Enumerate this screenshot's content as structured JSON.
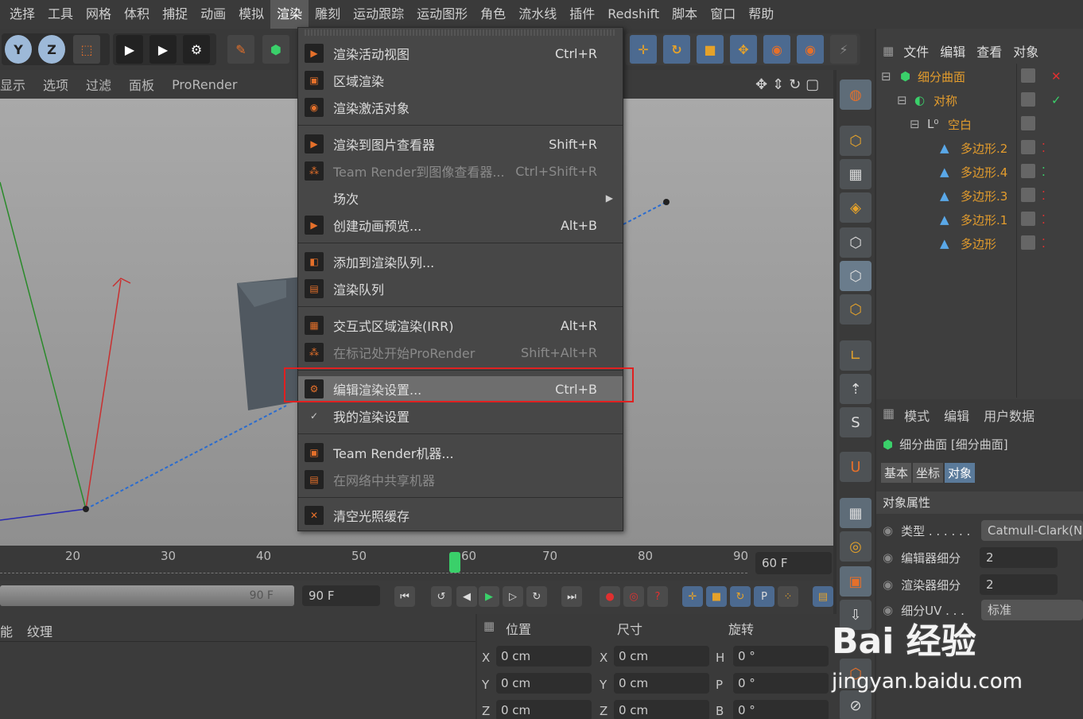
{
  "menubar": [
    "选择",
    "工具",
    "网格",
    "体积",
    "捕捉",
    "动画",
    "模拟",
    "渲染",
    "雕刻",
    "运动跟踪",
    "运动图形",
    "角色",
    "流水线",
    "插件",
    "Redshift",
    "脚本",
    "窗口",
    "帮助"
  ],
  "viewport_menu": [
    "显示",
    "选项",
    "过滤",
    "面板",
    "ProRender"
  ],
  "render_menu": [
    {
      "label": "渲染活动视图",
      "shortcut": "Ctrl+R",
      "disabled": false
    },
    {
      "label": "区域渲染",
      "shortcut": "",
      "disabled": false
    },
    {
      "label": "渲染激活对象",
      "shortcut": "",
      "disabled": false
    },
    {
      "label": "渲染到图片查看器",
      "shortcut": "Shift+R",
      "disabled": false
    },
    {
      "label": "Team Render到图像查看器...",
      "shortcut": "Ctrl+Shift+R",
      "disabled": true
    },
    {
      "label": "场次",
      "shortcut": "",
      "disabled": false
    },
    {
      "label": "创建动画预览...",
      "shortcut": "Alt+B",
      "disabled": false
    },
    {
      "label": "添加到渲染队列...",
      "shortcut": "",
      "disabled": false
    },
    {
      "label": "渲染队列",
      "shortcut": "",
      "disabled": false
    },
    {
      "label": "交互式区域渲染(IRR)",
      "shortcut": "Alt+R",
      "disabled": false
    },
    {
      "label": "在标记处开始ProRender",
      "shortcut": "Shift+Alt+R",
      "disabled": true
    },
    {
      "label": "编辑渲染设置...",
      "shortcut": "Ctrl+B",
      "disabled": false
    },
    {
      "label": "我的渲染设置",
      "shortcut": "",
      "disabled": false
    },
    {
      "label": "Team Render机器...",
      "shortcut": "",
      "disabled": false
    },
    {
      "label": "在网络中共享机器",
      "shortcut": "",
      "disabled": true
    },
    {
      "label": "清空光照缓存",
      "shortcut": "",
      "disabled": false
    }
  ],
  "object_manager": {
    "tabs": [
      "文件",
      "编辑",
      "查看",
      "对象"
    ],
    "objects": [
      "细分曲面",
      "对称",
      "空白",
      "多边形.2",
      "多边形.4",
      "多边形.3",
      "多边形.1",
      "多边形"
    ]
  },
  "attributes": {
    "tabs": [
      "模式",
      "编辑",
      "用户数据"
    ],
    "object_title": "细分曲面 [细分曲面]",
    "subtabs": [
      "基本",
      "坐标",
      "对象"
    ],
    "section": "对象属性",
    "rows": [
      {
        "label": "类型 . . . . . .",
        "value": "Catmull-Clark(N"
      },
      {
        "label": "编辑器细分",
        "value": "2"
      },
      {
        "label": "渲染器细分",
        "value": "2"
      },
      {
        "label": "细分UV . . .",
        "value": "标准"
      }
    ]
  },
  "timeline": {
    "ticks": [
      "20",
      "30",
      "40",
      "50",
      "60",
      "70",
      "80",
      "90"
    ],
    "current_frame": "60",
    "end_frame": "60 F",
    "max_frame_a": "90 F",
    "max_frame_b": "90 F"
  },
  "material_panel": [
    "能",
    "纹理"
  ],
  "coords": {
    "headers": [
      "位置",
      "尺寸",
      "旋转"
    ],
    "rows": [
      {
        "a": "X",
        "av": "0 cm",
        "b": "X",
        "bv": "0 cm",
        "c": "H",
        "cv": "0 °"
      },
      {
        "a": "Y",
        "av": "0 cm",
        "b": "Y",
        "bv": "0 cm",
        "c": "P",
        "cv": "0 °"
      },
      {
        "a": "Z",
        "av": "0 cm",
        "b": "Z",
        "bv": "0 cm",
        "c": "B",
        "cv": "0 °"
      }
    ]
  },
  "watermark": {
    "logo": "Bai 经验",
    "url": "jingyan.baidu.com"
  },
  "colors": {
    "highlight_box": "#e02020",
    "object_name": "#e39c2d",
    "accent": "#e5702a"
  }
}
